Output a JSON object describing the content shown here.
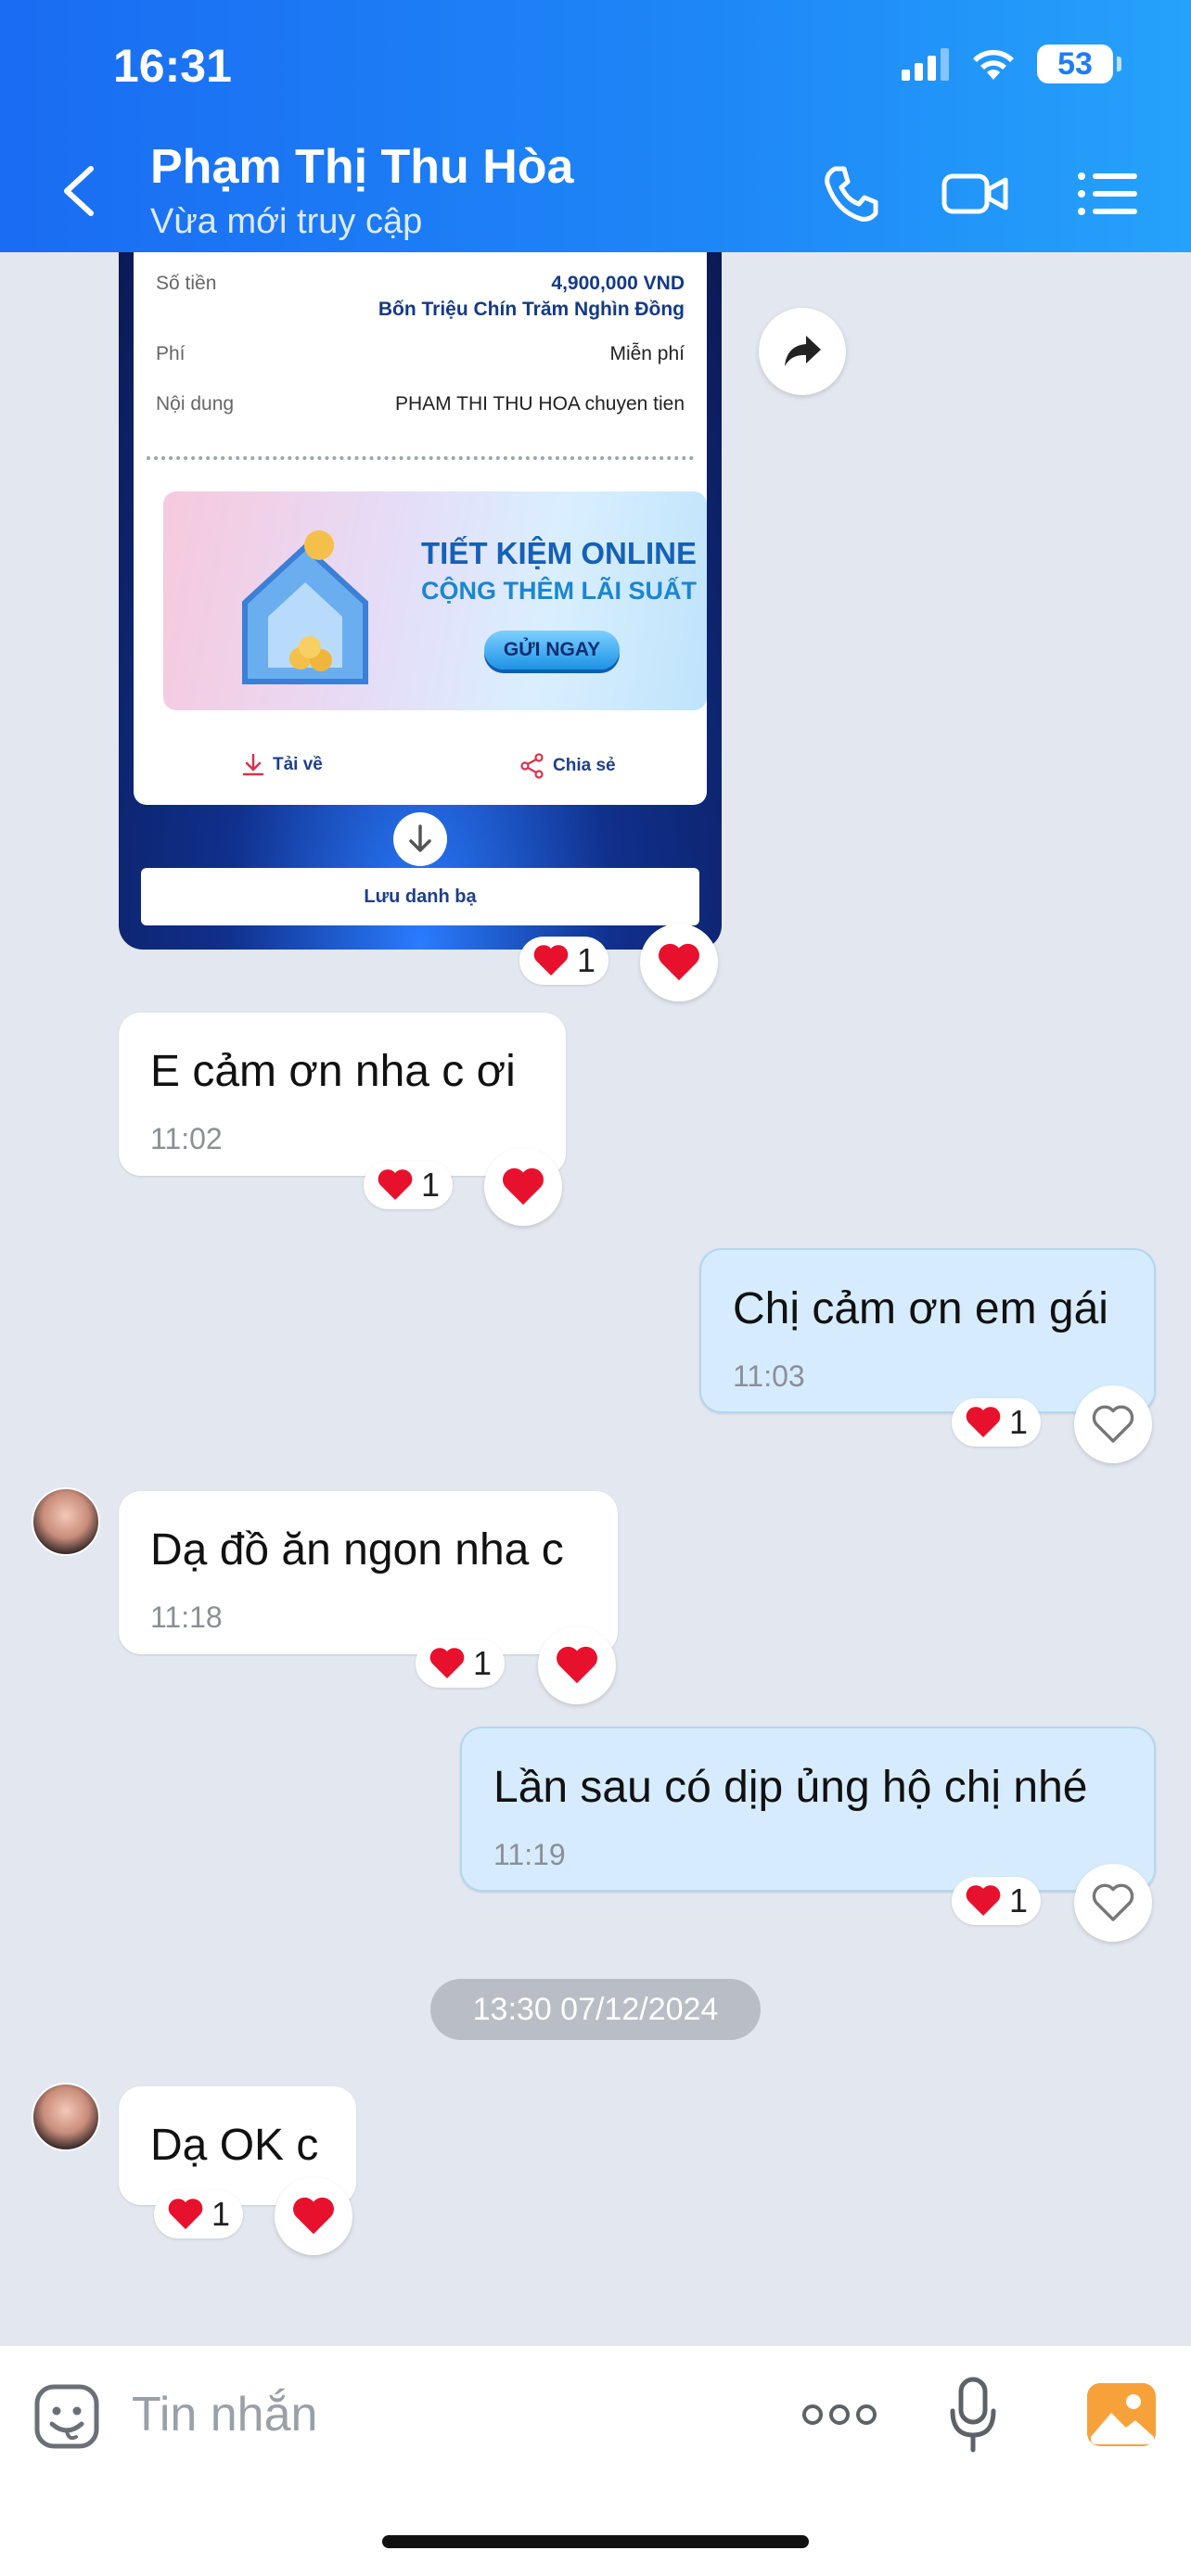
{
  "status_bar": {
    "time": "16:31",
    "battery": "53"
  },
  "header": {
    "contact_name": "Phạm Thị Thu Hòa",
    "status": "Vừa mới truy cập"
  },
  "transfer_card": {
    "amount_label": "Số tiền",
    "amount_value": "4,900,000 VND",
    "amount_words": "Bốn Triệu Chín Trăm Nghìn Đồng",
    "fee_label": "Phí",
    "fee_value": "Miễn phí",
    "content_label": "Nội dung",
    "content_value": "PHAM THI THU HOA chuyen tien",
    "promo_line1": "TIẾT KIỆM ONLINE",
    "promo_line2": "CỘNG THÊM LÃI SUẤT",
    "promo_button": "GỬI NGAY",
    "download_label": "Tải về",
    "share_label": "Chia sẻ",
    "save_contact_label": "Lưu danh bạ",
    "reaction_count": "1"
  },
  "messages": [
    {
      "direction": "in",
      "text": "E cảm ơn nha c ơi",
      "time": "11:02",
      "reaction_count": "1"
    },
    {
      "direction": "out",
      "text": "Chị cảm ơn em gái",
      "time": "11:03",
      "reaction_count": "1"
    },
    {
      "direction": "in",
      "text": "Dạ đồ ăn ngon nha c",
      "time": "11:18",
      "reaction_count": "1"
    },
    {
      "direction": "out",
      "text": "Lần sau có dịp ủng hộ chị nhé",
      "time": "11:19",
      "reaction_count": "1"
    },
    {
      "direction": "in",
      "text": "Dạ OK c",
      "time": "",
      "reaction_count": "1"
    }
  ],
  "date_separator": "13:30 07/12/2024",
  "composer": {
    "placeholder": "Tin nhắn"
  },
  "colors": {
    "header_start": "#1a6cf2",
    "header_end": "#25a2fb",
    "out_bubble": "#d6ecfe",
    "heart": "#e8112d"
  }
}
